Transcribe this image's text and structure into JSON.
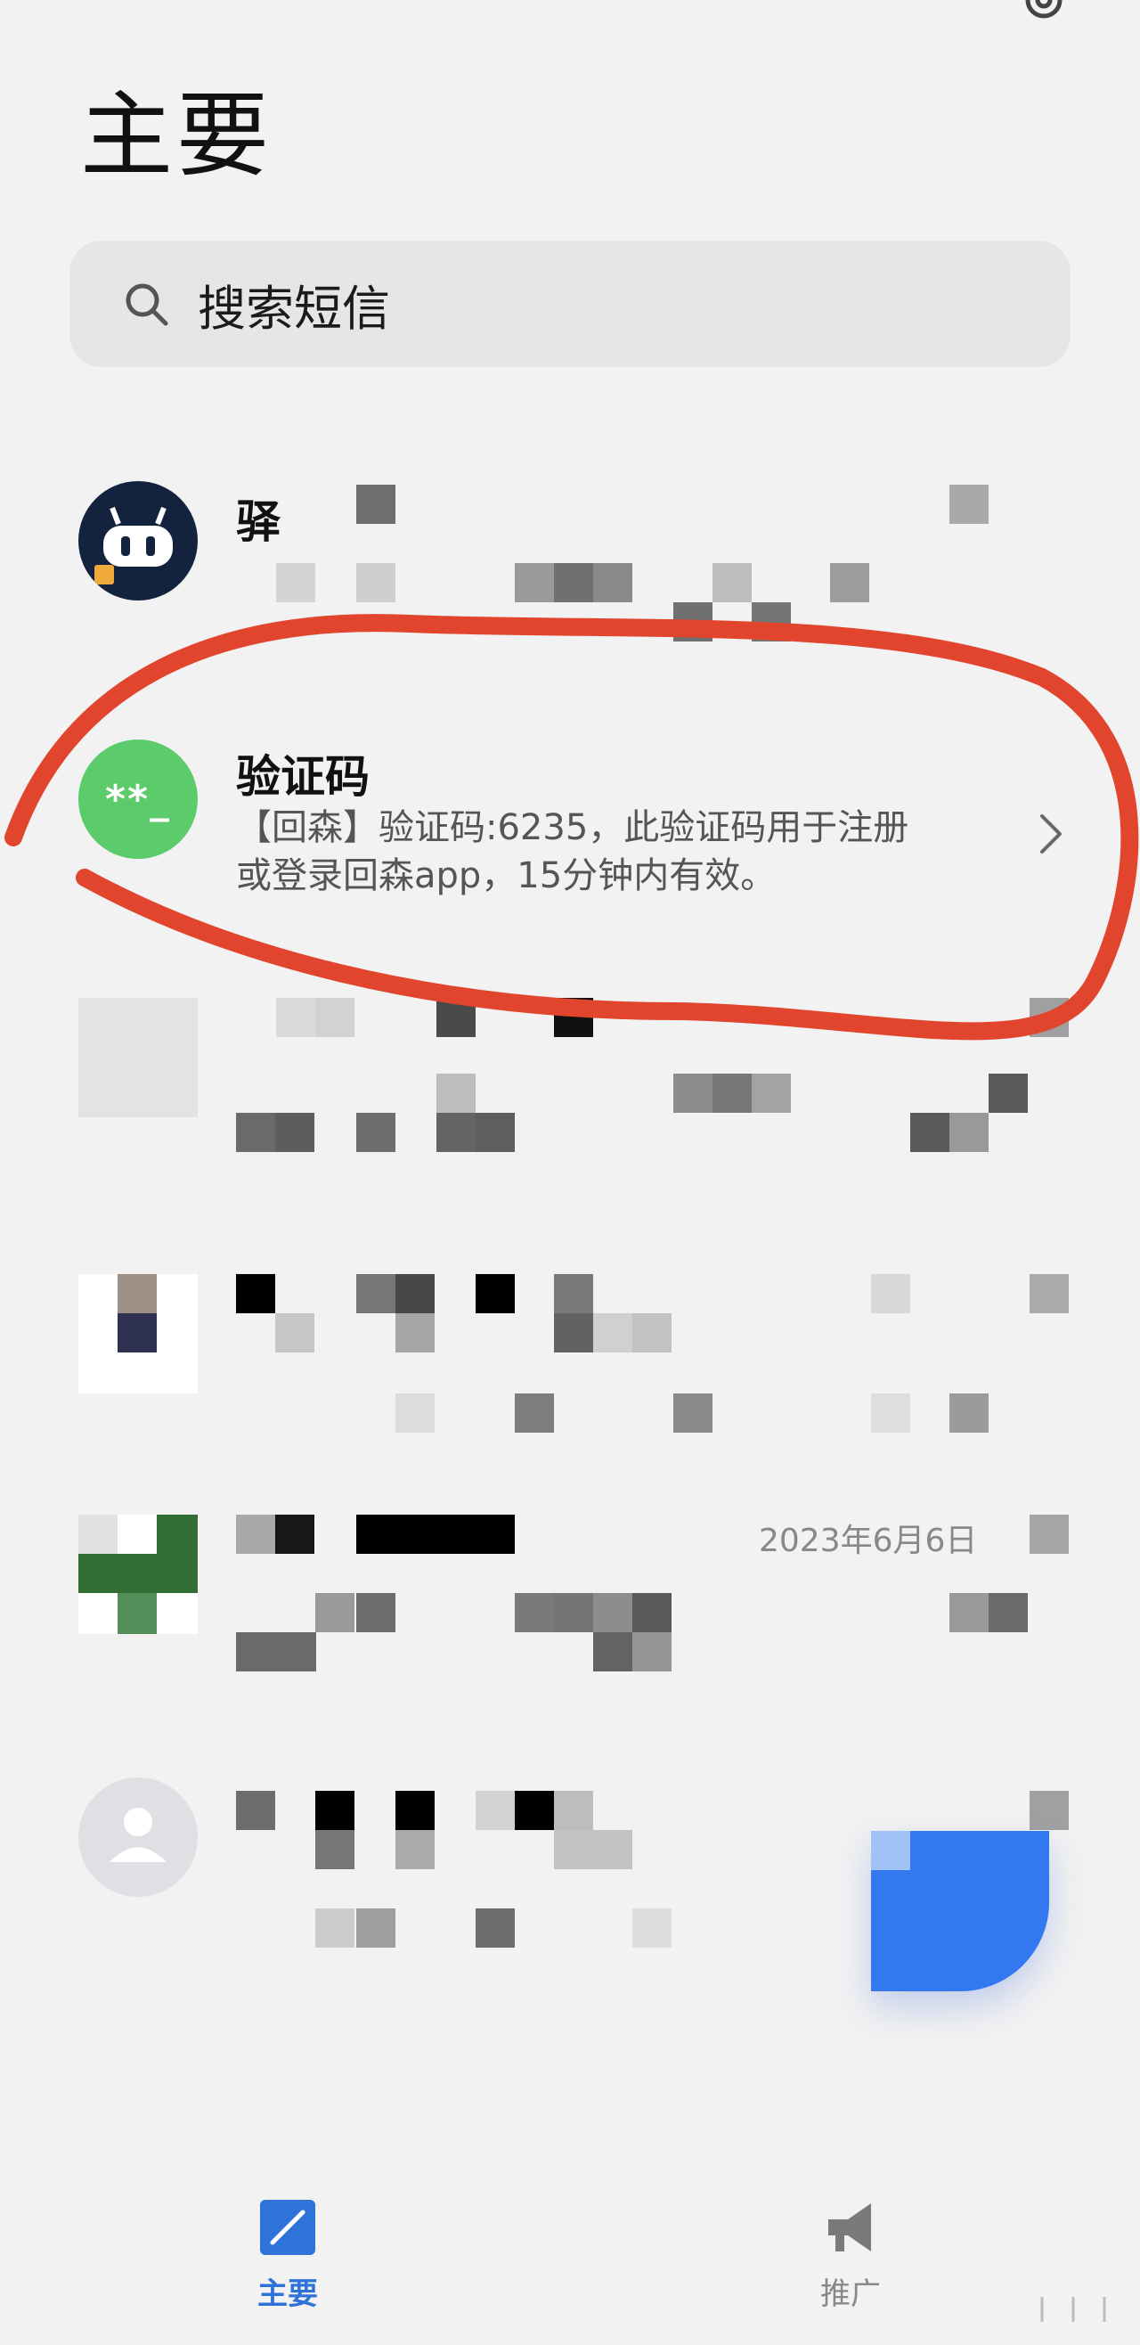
{
  "header": {
    "title": "主要"
  },
  "search": {
    "placeholder": "搜索短信"
  },
  "conversations": [
    {
      "name": "验证码",
      "preview_line1": "【回森】验证码:6235，此验证码用于注册",
      "preview_line2": "或登录回森app，15分钟内有效。",
      "avatar_text": "**_",
      "avatar_color": "#5ccb6b"
    }
  ],
  "partial_texts": {
    "row1_name_partial": "驿",
    "row5_date_partial": "2023年6月6日"
  },
  "bottom_nav": {
    "main_label": "主要",
    "promo_label": "推广"
  },
  "colors": {
    "accent": "#2f73d9",
    "annotation": "#e2452e",
    "fab": "#3378f0",
    "background": "#f2f2f2"
  },
  "icons": {
    "search": "search-icon",
    "settings": "gear-icon",
    "chevron": "chevron-right-icon",
    "compose": "compose-icon",
    "promo": "megaphone-icon"
  }
}
